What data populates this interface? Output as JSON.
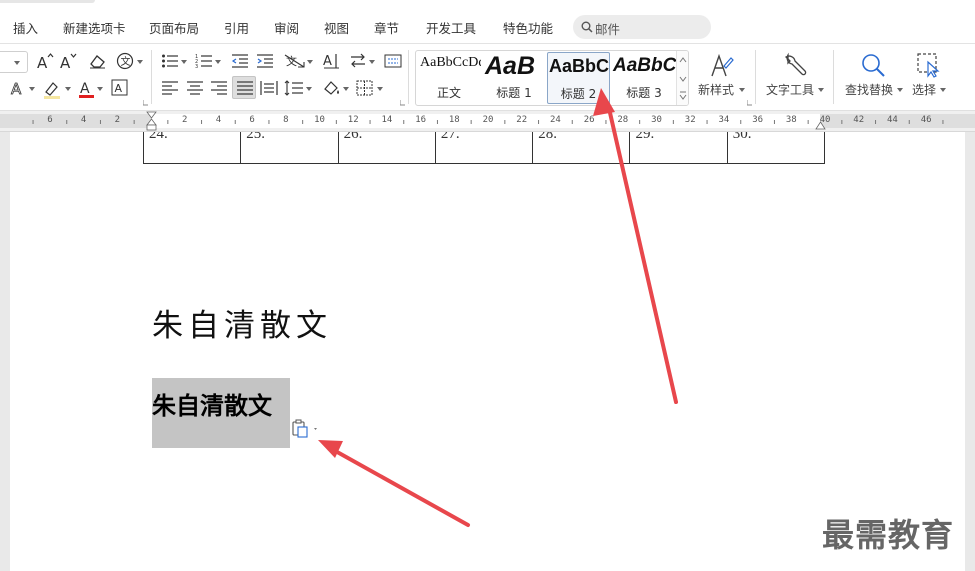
{
  "tabs": [
    "插入",
    "新建选项卡",
    "页面布局",
    "引用",
    "审阅",
    "视图",
    "章节",
    "开发工具",
    "特色功能"
  ],
  "search": {
    "text": "邮件"
  },
  "styles": [
    {
      "sample": "AaBbCcDd",
      "label": "正文"
    },
    {
      "sample": "AaB",
      "label": "标题 1"
    },
    {
      "sample": "AaBbC",
      "label": "标题 2"
    },
    {
      "sample": "AaBbCc",
      "label": "标题 3"
    }
  ],
  "ribbon_buttons": {
    "new_style": "新样式",
    "text_tools": "文字工具",
    "find_replace": "查找替换",
    "select": "选择"
  },
  "ruler": {
    "numbers": [
      "6",
      "4",
      "2",
      "2",
      "4",
      "6",
      "8",
      "10",
      "12",
      "14",
      "16",
      "18",
      "20",
      "22",
      "24",
      "26",
      "28",
      "30",
      "32",
      "34",
      "36",
      "38",
      "40",
      "42",
      "44",
      "46"
    ]
  },
  "table_row": [
    "24.",
    "25.",
    "26.",
    "27.",
    "28.",
    "29.",
    "30."
  ],
  "document": {
    "heading_plain": "朱自清散文",
    "heading_bold": "朱自清散文"
  },
  "watermark": "最需教育",
  "colors": {
    "arrow": "#e8474c",
    "selection": "#c4c4c4",
    "font_color_underline": "#e02020",
    "highlight": "#f5e6a0"
  },
  "icons": [
    "search-icon",
    "font-grow-icon",
    "font-shrink-icon",
    "eraser-icon",
    "phonetic-icon",
    "bullets-icon",
    "numbering-icon",
    "indent-icon",
    "sort-icon",
    "paste-options-icon",
    "wrench-icon",
    "magnifier-icon",
    "select-icon"
  ]
}
